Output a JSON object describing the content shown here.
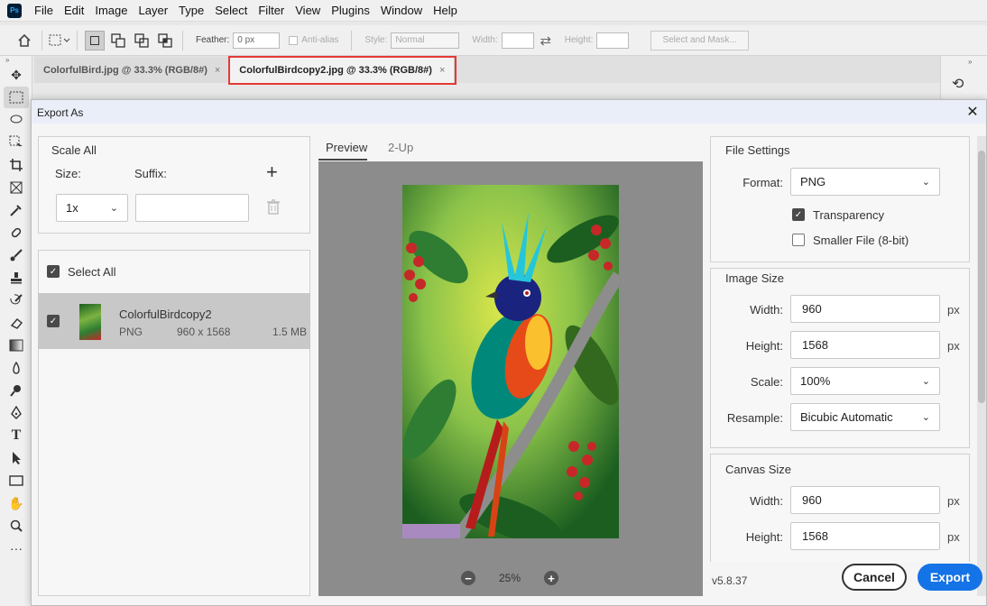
{
  "app": {
    "logo": "Ps"
  },
  "menu": [
    "File",
    "Edit",
    "Image",
    "Layer",
    "Type",
    "Select",
    "Filter",
    "View",
    "Plugins",
    "Window",
    "Help"
  ],
  "options": {
    "feather_label": "Feather:",
    "feather_value": "0 px",
    "antialias_label": "Anti-alias",
    "style_label": "Style:",
    "style_value": "Normal",
    "width_label": "Width:",
    "height_label": "Height:",
    "select_mask": "Select and Mask..."
  },
  "tabs": [
    {
      "label": "ColorfulBird.jpg @ 33.3% (RGB/8#)",
      "close": "×"
    },
    {
      "label": "ColorfulBirdcopy2.jpg @ 33.3% (RGB/8#)",
      "close": "×"
    }
  ],
  "dialog": {
    "title": "Export As",
    "close": "✕",
    "scale_all": {
      "title": "Scale All",
      "size_label": "Size:",
      "suffix_label": "Suffix:",
      "size_value": "1x",
      "add": "+"
    },
    "assets": {
      "select_all": "Select All",
      "item_name": "ColorfulBirdcopy2",
      "item_format": "PNG",
      "item_dims": "960 x 1568",
      "item_size": "1.5 MB"
    },
    "preview": {
      "tab_preview": "Preview",
      "tab_2up": "2-Up",
      "zoom": "25%",
      "zoom_out": "−",
      "zoom_in": "+"
    },
    "file_settings": {
      "title": "File Settings",
      "format_label": "Format:",
      "format_value": "PNG",
      "transparency": "Transparency",
      "smaller_file": "Smaller File (8-bit)"
    },
    "image_size": {
      "title": "Image Size",
      "width_label": "Width:",
      "width_value": "960",
      "height_label": "Height:",
      "height_value": "1568",
      "scale_label": "Scale:",
      "scale_value": "100%",
      "resample_label": "Resample:",
      "resample_value": "Bicubic Automatic",
      "unit": "px"
    },
    "canvas_size": {
      "title": "Canvas Size",
      "width_label": "Width:",
      "width_value": "960",
      "height_label": "Height:",
      "height_value": "1568",
      "unit": "px"
    },
    "version": "v5.8.37",
    "cancel": "Cancel",
    "export": "Export"
  },
  "colors": {
    "accent": "#1473e6",
    "highlight": "#e53935"
  }
}
